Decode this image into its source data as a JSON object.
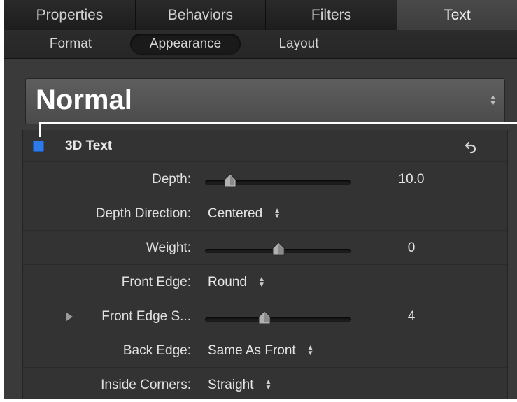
{
  "tabs": [
    {
      "label": "Properties",
      "active": false
    },
    {
      "label": "Behaviors",
      "active": false
    },
    {
      "label": "Filters",
      "active": false
    },
    {
      "label": "Text",
      "active": true
    }
  ],
  "subtabs": [
    {
      "label": "Format",
      "selected": false
    },
    {
      "label": "Appearance",
      "selected": true
    },
    {
      "label": "Layout",
      "selected": false
    }
  ],
  "preset": {
    "value": "Normal",
    "icon": "updown-arrows-icon"
  },
  "group": {
    "title": "3D Text",
    "enabled": true,
    "checkbox_color": "#2d7be8",
    "reset_icon": "undo-arrow-icon"
  },
  "rows": {
    "depth": {
      "label": "Depth:",
      "value": "10.0",
      "slider_fraction": 0.14
    },
    "depth_direction": {
      "label": "Depth Direction:",
      "value": "Centered"
    },
    "weight": {
      "label": "Weight:",
      "value": "0",
      "slider_fraction": 0.5
    },
    "front_edge": {
      "label": "Front Edge:",
      "value": "Round"
    },
    "front_edge_size": {
      "label": "Front Edge S...",
      "value": "4",
      "slider_fraction": 0.4
    },
    "back_edge": {
      "label": "Back Edge:",
      "value": "Same As Front"
    },
    "inside_corners": {
      "label": "Inside Corners:",
      "value": "Straight"
    }
  }
}
